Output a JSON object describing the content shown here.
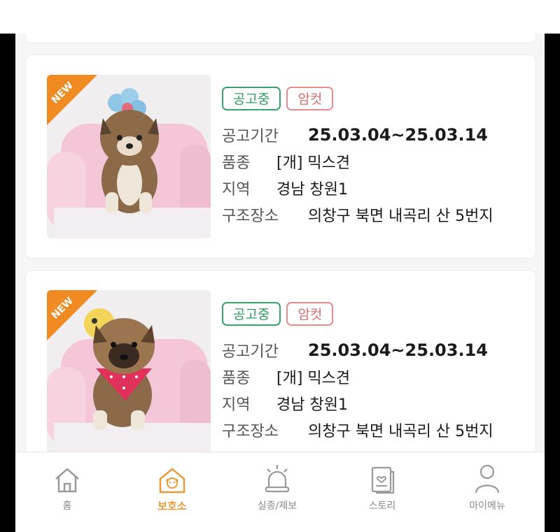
{
  "colors": {
    "status_tag": "#37a36a",
    "sex_tag": "#e58d8d",
    "new_badge": "#f08a22",
    "nav_active": "#e89a3a",
    "nav_inactive": "#8a8a8a"
  },
  "listings": [
    {
      "badge": "NEW",
      "status_tag": "공고중",
      "sex_tag": "암컷",
      "period_label": "공고기간",
      "period_value": "25.03.04~25.03.14",
      "breed_label": "품종",
      "breed_value": "[개] 믹스견",
      "region_label": "지역",
      "region_value": "경남 창원1",
      "rescue_label": "구조장소",
      "rescue_value": "의창구 북면 내곡리 산 5번지"
    },
    {
      "badge": "NEW",
      "status_tag": "공고중",
      "sex_tag": "암컷",
      "period_label": "공고기간",
      "period_value": "25.03.04~25.03.14",
      "breed_label": "품종",
      "breed_value": "[개] 믹스견",
      "region_label": "지역",
      "region_value": "경남 창원1",
      "rescue_label": "구조장소",
      "rescue_value": "의창구 북면 내곡리 산 5번지"
    }
  ],
  "nav": {
    "items": [
      {
        "label": "홈",
        "icon": "home-icon"
      },
      {
        "label": "보호소",
        "icon": "shelter-icon",
        "active": true
      },
      {
        "label": "실종/제보",
        "icon": "siren-icon"
      },
      {
        "label": "스토리",
        "icon": "story-icon"
      },
      {
        "label": "마이메뉴",
        "icon": "person-icon"
      }
    ]
  }
}
